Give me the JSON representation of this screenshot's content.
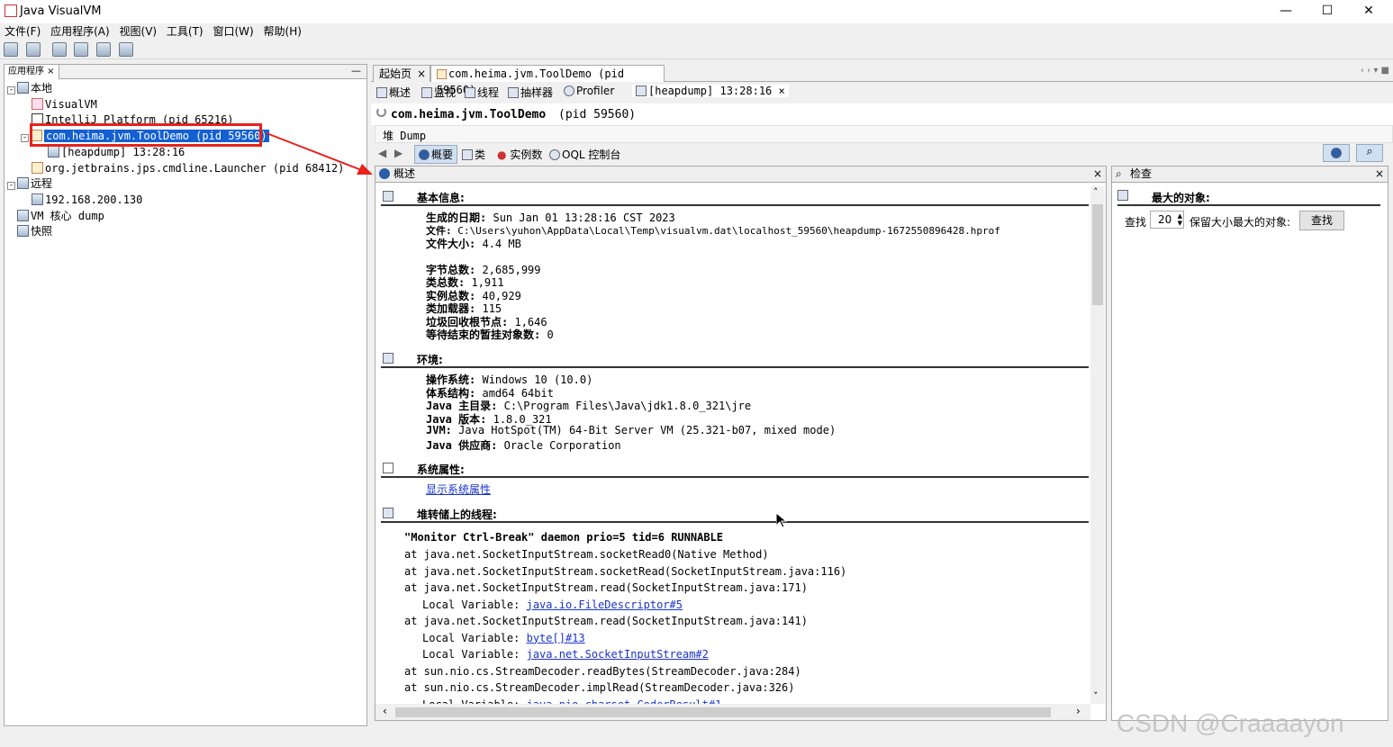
{
  "window": {
    "title": "Java VisualVM",
    "min": "—",
    "max": "☐",
    "close": "✕"
  },
  "menu": [
    "文件(F)",
    "应用程序(A)",
    "视图(V)",
    "工具(T)",
    "窗口(W)",
    "帮助(H)"
  ],
  "left": {
    "tab_label": "应用程序 ×",
    "minimize": "—",
    "tree": [
      {
        "label": "本地",
        "level": 0
      },
      {
        "label": "VisualVM",
        "level": 1
      },
      {
        "label": "IntelliJ Platform (pid 65216)",
        "level": 1
      },
      {
        "label": "com.heima.jvm.ToolDemo (pid 59560)",
        "level": 1
      },
      {
        "label": "[heapdump] 13:28:16",
        "level": 2
      },
      {
        "label": "org.jetbrains.jps.cmdline.Launcher (pid 68412)",
        "level": 1
      },
      {
        "label": "远程",
        "level": 0
      },
      {
        "label": "192.168.200.130",
        "level": 1
      },
      {
        "label": "VM 核心 dump",
        "level": 0
      },
      {
        "label": "快照",
        "level": 0
      }
    ]
  },
  "tabs": [
    {
      "label": "起始页",
      "close": "×"
    },
    {
      "label": "com.heima.jvm.ToolDemo (pid 59560)",
      "close": "×"
    }
  ],
  "corner_nav": "‹  ›  ▾  ■",
  "subtabs": [
    "概述",
    "监视",
    "线程",
    "抽样器",
    "Profiler",
    "[heapdump] 13:28:16"
  ],
  "subtab_close": "×",
  "content_title": "com.heima.jvm.ToolDemo",
  "content_pid": "(pid 59560)",
  "dump_label": "堆 Dump",
  "nav": {
    "back": "◀",
    "forward": "▶",
    "items": [
      "概要",
      "类",
      "实例数",
      "OQL 控制台"
    ]
  },
  "overview": {
    "title": "概述",
    "close": "×",
    "basic": {
      "heading": "基本信息:",
      "rows": [
        {
          "k": "生成的日期:",
          "v": "Sun Jan 01 13:28:16 CST 2023"
        },
        {
          "k": "文件:",
          "v": "C:\\Users\\yuhon\\AppData\\Local\\Temp\\visualvm.dat\\localhost_59560\\heapdump-1672550896428.hprof"
        },
        {
          "k": "文件大小:",
          "v": "4.4 MB"
        },
        {
          "k": "字节总数:",
          "v": "2,685,999"
        },
        {
          "k": "类总数:",
          "v": "1,911"
        },
        {
          "k": "实例总数:",
          "v": "40,929"
        },
        {
          "k": "类加载器:",
          "v": "115"
        },
        {
          "k": "垃圾回收根节点:",
          "v": "1,646"
        },
        {
          "k": "等待结束的暂挂对象数:",
          "v": "0"
        }
      ]
    },
    "env": {
      "heading": "环境:",
      "rows": [
        {
          "k": "操作系统:",
          "v": "Windows 10 (10.0)"
        },
        {
          "k": "体系结构:",
          "v": "amd64 64bit"
        },
        {
          "k": "Java 主目录:",
          "v": "C:\\Program Files\\Java\\jdk1.8.0_321\\jre"
        },
        {
          "k": "Java 版本:",
          "v": "1.8.0_321"
        },
        {
          "k": "JVM:",
          "v": "Java HotSpot(TM) 64-Bit Server VM (25.321-b07, mixed mode)"
        },
        {
          "k": "Java 供应商:",
          "v": "Oracle Corporation"
        }
      ]
    },
    "sysprops": {
      "heading": "系统属性:",
      "link": "显示系统属性"
    },
    "threads": {
      "heading": "堆转储上的线程:",
      "header": "\"Monitor Ctrl-Break\" daemon prio=5 tid=6 RUNNABLE",
      "lines": [
        {
          "t": "at java.net.SocketInputStream.socketRead0(Native Method)",
          "indent": false,
          "link": ""
        },
        {
          "t": "at java.net.SocketInputStream.socketRead(SocketInputStream.java:116)",
          "indent": false,
          "link": ""
        },
        {
          "t": "at java.net.SocketInputStream.read(SocketInputStream.java:171)",
          "indent": false,
          "link": ""
        },
        {
          "t": "Local Variable: ",
          "indent": true,
          "link": "java.io.FileDescriptor#5"
        },
        {
          "t": "at java.net.SocketInputStream.read(SocketInputStream.java:141)",
          "indent": false,
          "link": ""
        },
        {
          "t": "Local Variable: ",
          "indent": true,
          "link": "byte[]#13"
        },
        {
          "t": "Local Variable: ",
          "indent": true,
          "link": "java.net.SocketInputStream#2"
        },
        {
          "t": "at sun.nio.cs.StreamDecoder.readBytes(StreamDecoder.java:284)",
          "indent": false,
          "link": ""
        },
        {
          "t": "at sun.nio.cs.StreamDecoder.implRead(StreamDecoder.java:326)",
          "indent": false,
          "link": ""
        },
        {
          "t": "Local Variable: ",
          "indent": true,
          "link": "java.nio.charset.CoderResult#1"
        }
      ]
    },
    "scroll_left": "‹",
    "scroll_right": "›",
    "scroll_up": "˄",
    "scroll_down": "˅"
  },
  "inspect": {
    "title": "检查",
    "close": "×",
    "heading": "最大的对象:",
    "find_label": "查找",
    "count": "20",
    "suffix": "保留大小最大的对象:",
    "button": "查找"
  },
  "watermark": "CSDN @Craaaayon",
  "colors": {
    "selection": "#1460d2",
    "annotation": "#e8211b",
    "link": "#1a33cc"
  }
}
